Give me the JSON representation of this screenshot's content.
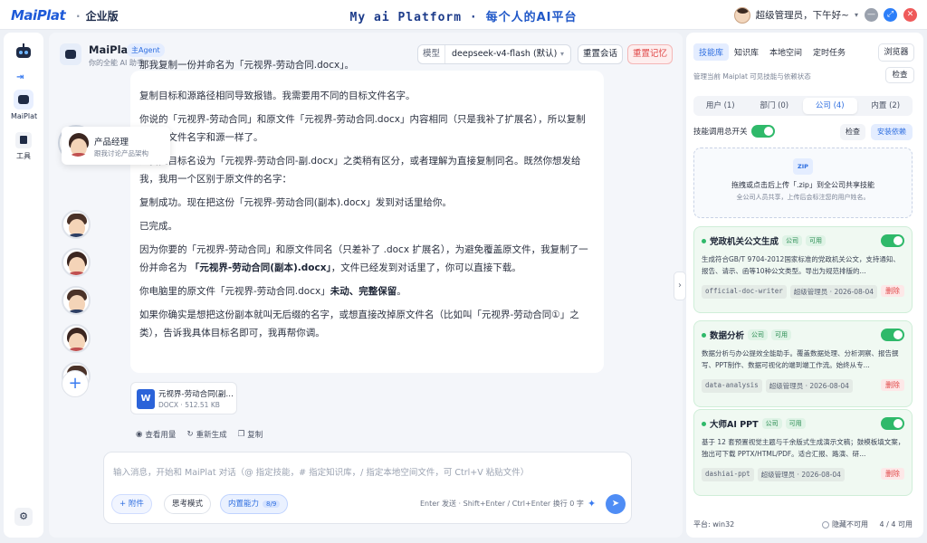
{
  "app": {
    "logo": "MaiPlat",
    "edition": "企业版",
    "center_title": "My ai Platform",
    "center_slogan": "每个人的AI平台",
    "user_label": "超级管理员，下午好~"
  },
  "rail": {
    "mp_label": "MaiPlat",
    "tool_label": "工具"
  },
  "header": {
    "agent_name": "MaiPlat",
    "agent_badge": "主Agent",
    "agent_sub": "你的全能 AI 助手",
    "model_label": "模型",
    "model_value": "deepseek-v4-flash (默认)",
    "reset_label": "重置会话",
    "memory_label": "重置记忆"
  },
  "tooltip": {
    "title": "产品经理",
    "sub": "跟我讨论产品架构"
  },
  "message": {
    "clip": "那我复制一份并命名为「元视界-劳动合同.docx」。",
    "p1": "复制目标和源路径相同导致报错。我需要用不同的目标文件名字。",
    "p2": "你说的「元视界-劳动合同」和原文件「元视界-劳动合同.docx」内容相同（只是我补了扩展名），所以复制出来的文件名字和源一样了。",
    "p3": "让我把目标名设为「元视界-劳动合同-副.docx」之类稍有区分，或者理解为直接复制同名。既然你想发给我，我用一个区别于原文件的名字：",
    "p4": "复制成功。现在把这份「元视界-劳动合同(副本).docx」发到对话里给你。",
    "p5": "已完成。",
    "p6a": "因为你要的「元视界-劳动合同」和原文件同名（只差补了 .docx 扩展名），为避免覆盖原文件，我复制了一份并命名为",
    "p6b": "「元视界-劳动合同(副本).docx」",
    "p6c": "，文件已经发到对话里了，你可以直接下载。",
    "p7a": "你电脑里的原文件「元视界-劳动合同.docx」",
    "p7b": "未动、完整保留",
    "p7c": "。",
    "p8": "如果你确实是想把这份副本就叫无后缀的名字，或想直接改掉原文件名（比如叫「元视界-劳动合同①」之类），告诉我具体目标名即可，我再帮你调。"
  },
  "file": {
    "name": "元视界-劳动合同(副本).docx",
    "meta": "DOCX · 512.51 KB",
    "icon_letter": "W"
  },
  "actions": {
    "usage": "查看用量",
    "regen": "重新生成",
    "copy": "复制"
  },
  "composer": {
    "placeholder": "输入消息，开始和 MaiPlat 对话（@ 指定技能，# 指定知识库，/ 指定本地空间文件，可 Ctrl+V 粘贴文件）",
    "attach": "附件",
    "think": "思考模式",
    "builtin": "内置能力",
    "builtin_count": "8/9",
    "hint": "Enter 发送 · Shift+Enter / Ctrl+Enter 换行  0 字"
  },
  "right": {
    "tabs": [
      "技能库",
      "知识库",
      "本地空间",
      "定时任务"
    ],
    "browser": "浏览器",
    "sub": "管理当前 Maiplat 可见技能与依赖状态",
    "check": "检查",
    "scopes": [
      "用户 (1)",
      "部门 (0)",
      "公司 (4)",
      "内置 (2)"
    ],
    "master_label": "技能调用总开关",
    "master_check": "检查",
    "master_install": "安装依赖",
    "drop_zip": "ZIP",
    "drop_l1": "拖拽或点击后上传「.zip」到全公司共享技能",
    "drop_l2": "全公司人员共享，上传后会标注您的用户姓名。",
    "skills": [
      {
        "name": "党政机关公文生成",
        "tag1": "公司",
        "tag2": "可用",
        "desc": "生成符合GB/T 9704-2012国家标准的党政机关公文，支持通知、报告、请示、函等10种公文类型。导出为规范排版的...",
        "code": "official-doc-writer",
        "owner": "超级管理员 · 2026-08-04",
        "del": "删除"
      },
      {
        "name": "数据分析",
        "tag1": "公司",
        "tag2": "可用",
        "desc": "数据分析与办公提效全能助手。覆盖数据处理、分析洞察、报告撰写、PPT制作、数据可视化的端到端工作流。始终从专...",
        "code": "data-analysis",
        "owner": "超级管理员 · 2026-08-04",
        "del": "删除"
      },
      {
        "name": "大师AI PPT",
        "tag1": "公司",
        "tag2": "可用",
        "desc": "基于 12 套预置视觉主题与千余版式生成演示文稿；鼓模板填文案，独出可下载 PPTX/HTML/PDF。适合汇报、路演、研...",
        "code": "dashiai-ppt",
        "owner": "超级管理员 · 2026-08-04",
        "del": "删除"
      }
    ],
    "platform": "平台: win32",
    "hide_label": "隐藏不可用",
    "count": "4 / 4 可用"
  }
}
